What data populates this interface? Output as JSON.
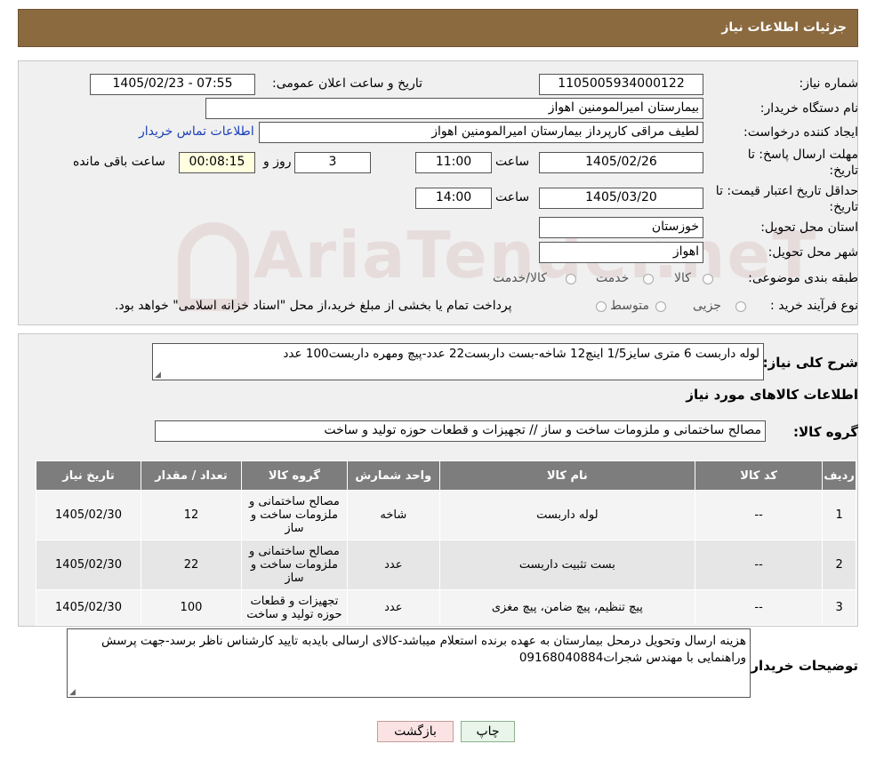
{
  "header": {
    "title": "جزئیات اطلاعات نیاز"
  },
  "fields": {
    "need_number_label": "شماره نیاز:",
    "need_number": "1105005934000122",
    "announce_label": "تاریخ و ساعت اعلان عمومی:",
    "announce_value": "1405/02/23 - 07:55",
    "buyer_label": "نام دستگاه خریدار:",
    "buyer_value": "بیمارستان امیرالمومنین اهواز",
    "creator_label": "ایجاد کننده درخواست:",
    "creator_value": "لطیف مراقی کارپرداز بیمارستان امیرالمومنین اهواز",
    "contact_link": "اطلاعات تماس خریدار",
    "deadline_label_1": "مهلت ارسال پاسخ: تا",
    "deadline_label_2": "تاریخ:",
    "deadline_date": "1405/02/26",
    "hour_label": "ساعت",
    "deadline_time": "11:00",
    "days_value": "3",
    "days_label": "روز و",
    "remaining_time": "00:08:15",
    "remaining_label": "ساعت باقی مانده",
    "validity_label_1": "حداقل تاریخ اعتبار قیمت: تا",
    "validity_label_2": "تاریخ:",
    "validity_date": "1405/03/20",
    "validity_time": "14:00",
    "province_label": "استان محل تحویل:",
    "province_value": "خوزستان",
    "city_label": "شهر محل تحویل:",
    "city_value": "اهواز",
    "category_label": "طبقه بندی موضوعی:",
    "category_options": [
      "کالا",
      "خدمت",
      "کالا/خدمت"
    ],
    "process_label": "نوع فرآیند خرید :",
    "process_options": [
      "جزیی",
      "متوسط"
    ],
    "process_note": "پرداخت تمام یا بخشی از مبلغ خرید،از محل \"اسناد خزانه اسلامی\" خواهد بود."
  },
  "summary": {
    "label": "شرح کلی نیاز:",
    "value": "لوله داربست 6 متری سایز1/5 اینچ12 شاخه-بست داربست22 عدد-پیچ ومهره داربست100 عدد"
  },
  "goods": {
    "section_title": "اطلاعات کالاهای مورد نیاز",
    "group_label": "گروه کالا:",
    "group_value": "مصالح ساختمانی و ملزومات ساخت و ساز // تجهیزات و قطعات حوزه تولید و ساخت",
    "columns": [
      "ردیف",
      "کد کالا",
      "نام کالا",
      "واحد شمارش",
      "گروه کالا",
      "تعداد / مقدار",
      "تاریخ نیاز"
    ],
    "rows": [
      {
        "n": "1",
        "code": "--",
        "name": "لوله داربست",
        "unit": "شاخه",
        "group": "مصالح ساختمانی و ملزومات ساخت و ساز",
        "qty": "12",
        "date": "1405/02/30"
      },
      {
        "n": "2",
        "code": "--",
        "name": "بست تثبیت داربست",
        "unit": "عدد",
        "group": "مصالح ساختمانی و ملزومات ساخت و ساز",
        "qty": "22",
        "date": "1405/02/30"
      },
      {
        "n": "3",
        "code": "--",
        "name": "پیچ تنظیم، پیچ ضامن، پیچ مغزی",
        "unit": "عدد",
        "group": "تجهیزات و قطعات حوزه تولید و ساخت",
        "qty": "100",
        "date": "1405/02/30"
      }
    ]
  },
  "buyer_notes": {
    "label": "توضیحات خریدار:",
    "value": "هزینه ارسال وتحویل درمحل بیمارستان به عهده برنده استعلام میباشد-کالای ارسالی بایدبه تایید کارشناس ناظر برسد-جهت پرسش وراهنمایی با مهندس شجرات09168040884"
  },
  "buttons": {
    "print": "چاپ",
    "back": "بازگشت"
  },
  "watermark": "AriaTender.neT",
  "colors": {
    "header_bg": "#8b6a3f",
    "table_header_bg": "#7d7d7d",
    "link": "#1a3fb8"
  }
}
